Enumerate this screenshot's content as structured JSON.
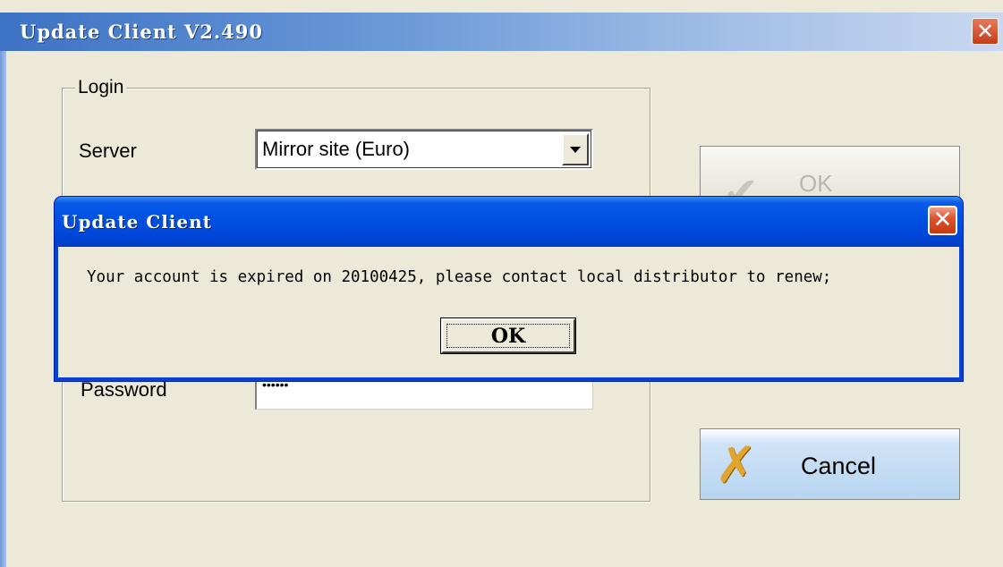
{
  "window": {
    "title": "Update Client V2.490",
    "close_glyph": "✕",
    "title_color": "#3d72c4"
  },
  "login": {
    "legend": "Login",
    "server_label": "Server",
    "server_value": "Mirror site (Euro)",
    "password_label": "Password",
    "password_value": "••••••"
  },
  "buttons": {
    "ok_label": "OK",
    "ok_enabled": false,
    "cancel_label": "Cancel"
  },
  "dialog": {
    "title": "Update Client",
    "close_glyph": "✕",
    "message": "Your account is expired on 20100425, please contact local distributor to renew;",
    "ok_label": "OK",
    "title_color": "#0052e3",
    "close_color": "#e0532d"
  }
}
